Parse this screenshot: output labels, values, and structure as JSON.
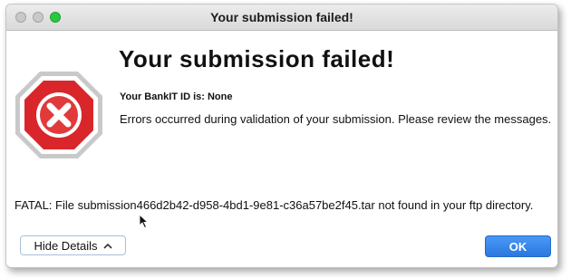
{
  "window": {
    "title": "Your submission failed!"
  },
  "dialog": {
    "heading": "Your submission failed!",
    "bankit_line": "Your BankIT ID is: None",
    "message": "Errors occurred during validation of your submission. Please review the messages.",
    "fatal": "FATAL: File submission466d2b42-d958-4bd1-9e81-c36a57be2f45.tar not found in your ftp directory."
  },
  "buttons": {
    "hide_details": "Hide Details",
    "ok": "OK"
  },
  "icons": {
    "error": "stop-sign-x-icon",
    "details_toggle": "chevron-up-icon",
    "cursor": "mouse-pointer-icon"
  },
  "colors": {
    "error_red": "#d9262b",
    "ok_blue": "#2a78e0"
  }
}
